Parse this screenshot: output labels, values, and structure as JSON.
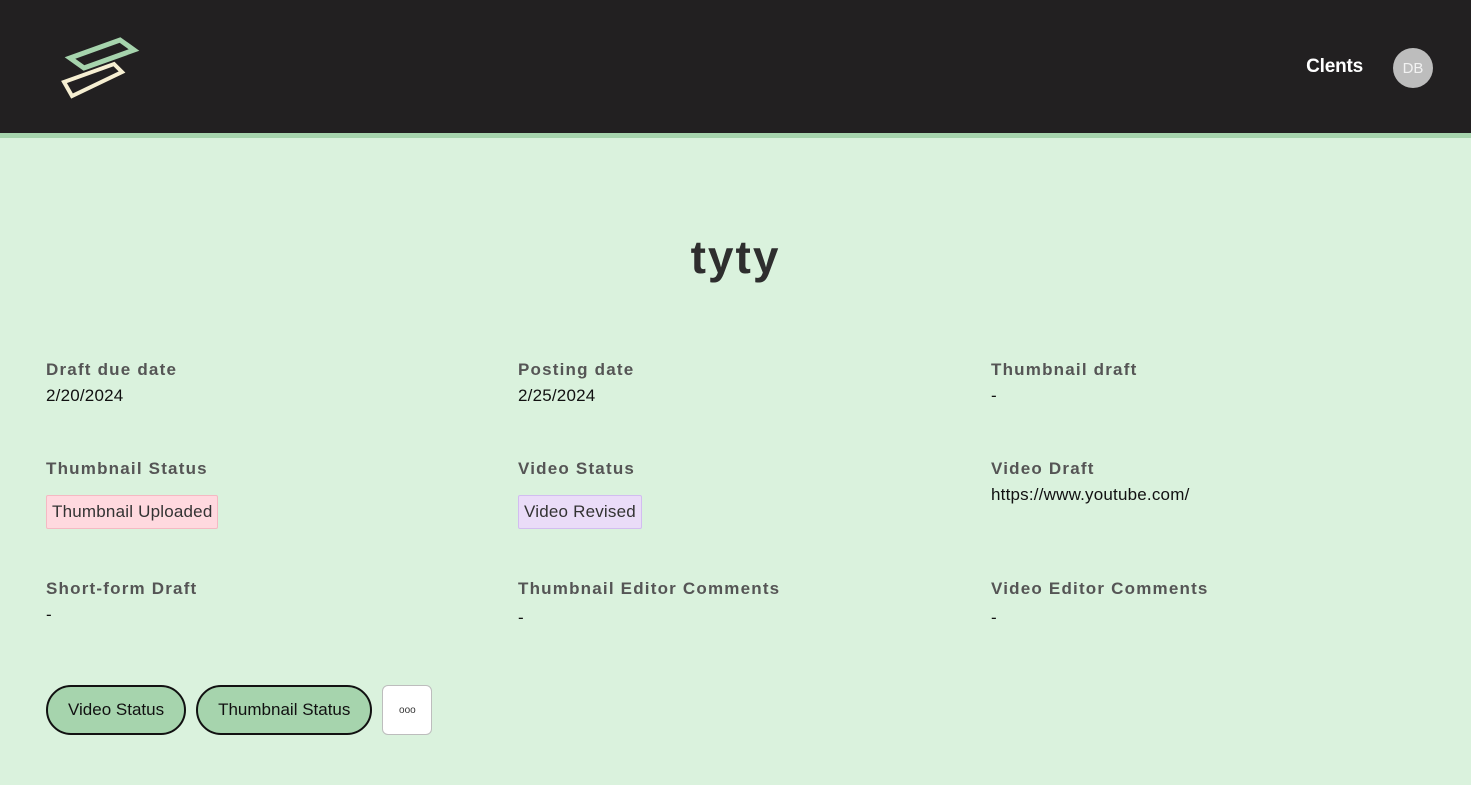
{
  "header": {
    "nav_link": "Clents",
    "avatar_initials": "DB",
    "colors": {
      "background": "#222021",
      "accent": "#a6d4ad"
    }
  },
  "page": {
    "title": "tyty",
    "background": "#daf2dd"
  },
  "fields": {
    "draft_due_date": {
      "label": "Draft due date",
      "value": "2/20/2024"
    },
    "posting_date": {
      "label": "Posting date",
      "value": "2/25/2024"
    },
    "thumbnail_draft": {
      "label": "Thumbnail draft",
      "value": "-"
    },
    "thumbnail_status": {
      "label": "Thumbnail Status",
      "value": "Thumbnail Uploaded",
      "color": "#ffd9df"
    },
    "video_status": {
      "label": "Video Status",
      "value": "Video Revised",
      "color": "#eadcf8"
    },
    "video_draft": {
      "label": "Video Draft",
      "value": "https://www.youtube.com/"
    },
    "short_form_draft": {
      "label": "Short-form Draft",
      "value": "-"
    },
    "thumbnail_editor_comments": {
      "label": "Thumbnail Editor Comments",
      "value": "-"
    },
    "video_editor_comments": {
      "label": "Video Editor Comments",
      "value": "-"
    }
  },
  "actions": {
    "video_status_label": "Video Status",
    "thumbnail_status_label": "Thumbnail Status",
    "more_label": "ooo"
  }
}
